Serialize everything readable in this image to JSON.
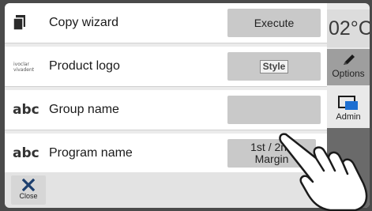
{
  "background": {
    "temperature": "02°C",
    "options_label": "Options",
    "admin_label": "Admin"
  },
  "rows": [
    {
      "icon": "copy-icon",
      "label": "Copy wizard",
      "button": "Execute"
    },
    {
      "icon": "ivoclar-logo-icon",
      "label": "Product logo",
      "button": "Style"
    },
    {
      "icon": "abc",
      "label": "Group name",
      "button": ""
    },
    {
      "icon": "abc",
      "label": "Program name",
      "button": "1st / 2nd Margin"
    }
  ],
  "close_label": "Close",
  "colors": {
    "dialog_bg": "#ebebeb",
    "button_bg": "#c9c9c9",
    "options_bg": "#9e9e9e",
    "accent_blue": "#1d3f6e"
  }
}
